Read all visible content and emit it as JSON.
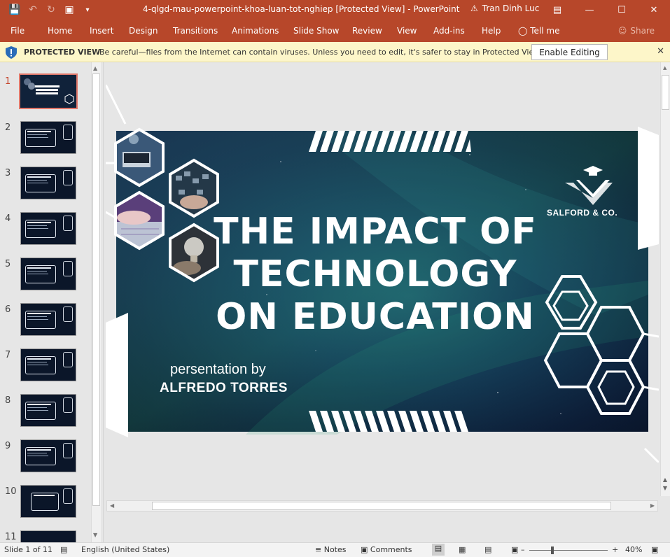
{
  "window": {
    "title": "4-qlgd-mau-powerpoint-khoa-luan-tot-nghiep [Protected View]  -  PowerPoint",
    "user": "Tran Dinh Luc"
  },
  "ribbon": {
    "tabs": [
      "File",
      "Home",
      "Insert",
      "Design",
      "Transitions",
      "Animations",
      "Slide Show",
      "Review",
      "View",
      "Add-ins",
      "Help",
      "Tell me"
    ],
    "share": "Share"
  },
  "protected_view": {
    "title": "PROTECTED VIEW",
    "message": "Be careful—files from the Internet can contain viruses. Unless you need to edit, it's safer to stay in Protected View.",
    "button": "Enable Editing"
  },
  "thumbnails": [
    "1",
    "2",
    "3",
    "4",
    "5",
    "6",
    "7",
    "8",
    "9",
    "10",
    "11"
  ],
  "slide": {
    "title_line1": "THE IMPACT OF",
    "title_line2": "TECHNOLOGY",
    "title_line3": "ON EDUCATION",
    "subtitle": "persentation by",
    "presenter": "ALFREDO TORRES",
    "brand": "SALFORD & CO."
  },
  "status": {
    "slide_count": "Slide 1 of 11",
    "language": "English (United States)",
    "notes": "Notes",
    "comments": "Comments",
    "zoom": "40%"
  },
  "colors": {
    "accent": "#b7472a",
    "slide_bg": "#0b1629",
    "protected_bg": "#fdf6c9"
  }
}
